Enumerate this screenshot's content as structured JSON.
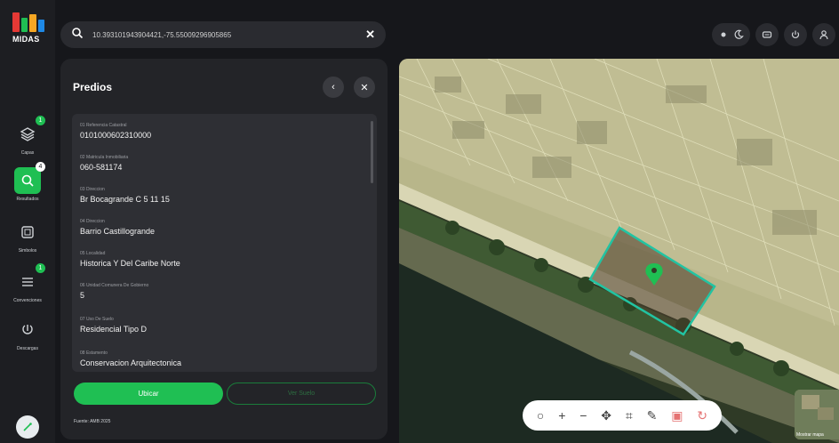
{
  "app": {
    "logo_text": "MIDAS",
    "logo_colors": [
      "#e53935",
      "#1fbf53",
      "#f5a623",
      "#1e88e5"
    ]
  },
  "rail": {
    "items": [
      {
        "label": "Capas",
        "badge": "1"
      },
      {
        "label": "Resultados",
        "badge": "4"
      },
      {
        "label": "Simbolos",
        "badge": ""
      },
      {
        "label": "Convenciones",
        "badge": "1"
      },
      {
        "label": "Descargas",
        "badge": ""
      }
    ]
  },
  "search": {
    "value": "10.393101943904421,-75.55009296905865"
  },
  "panel": {
    "title": "Predios",
    "fields": [
      {
        "key": "01 Referencia Catastral",
        "value": "0101000602310000"
      },
      {
        "key": "02 Matricula Inmobiliaria",
        "value": "060-581174"
      },
      {
        "key": "03 Direccion",
        "value": "Br Bocagrande C 5 11 15"
      },
      {
        "key": "04 Direccion",
        "value": "Barrio Castillogrande"
      },
      {
        "key": "05 Localidad",
        "value": "Historica Y Del Caribe Norte"
      },
      {
        "key": "06 Unidad Comunera De Gobierno",
        "value": "5"
      },
      {
        "key": "07 Uso De Suelo",
        "value": "Residencial Tipo D"
      },
      {
        "key": "08 Estamento",
        "value": "Conservacion Arquitectonica"
      }
    ],
    "primary_button": "Ubicar",
    "secondary_button": "Ver Suelo",
    "source": "Fuente: AMB 2025"
  },
  "map": {
    "basemap_label": "Mostrar mapa",
    "toolbar_icons": [
      "locate-icon",
      "zoom-in-icon",
      "zoom-out-icon",
      "pan-icon",
      "measure-area-icon",
      "draw-icon",
      "delete-icon",
      "reset-icon"
    ]
  },
  "colors": {
    "accent": "#1fbf53",
    "background": "#16171b",
    "panel": "#232428",
    "parcel_highlight": "#22c3a2"
  }
}
